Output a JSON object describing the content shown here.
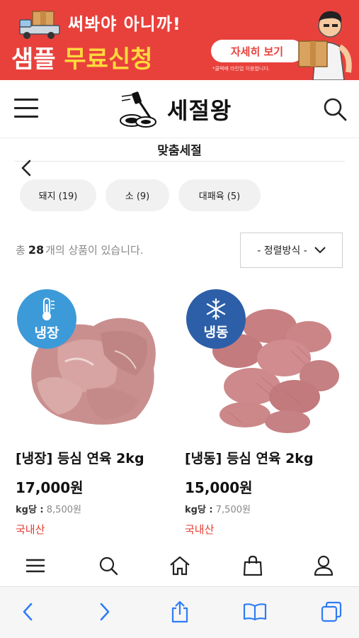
{
  "colors": {
    "banner_bg": "#e8413c",
    "banner_accent": "#ffd93d",
    "chilled_badge": "#3d9ad9",
    "frozen_badge": "#2d5fa8",
    "origin_text": "#e53b30",
    "browser_icon": "#2f7cf6"
  },
  "banner": {
    "tagline": "써봐야 아니까!",
    "headline_part1": "샘플 ",
    "headline_part2": "무료신청",
    "detail_button": "자세히 보기",
    "note": "*쿨택배 라인업 이용합니다."
  },
  "header": {
    "logo_text": "세절왕",
    "menu_icon": "hamburger-menu-icon",
    "search_icon": "search-icon"
  },
  "category": {
    "title": "맞춤세절",
    "chips": [
      {
        "label": "돼지 (19)"
      },
      {
        "label": "소 (9)"
      },
      {
        "label": "대패육 (5)"
      }
    ]
  },
  "listing": {
    "count_prefix": "총",
    "count_value": "28",
    "count_suffix": "개의 상품이 있습니다.",
    "sort_label": "- 정렬방식 -"
  },
  "products": [
    {
      "badge": "냉장",
      "badge_icon": "thermometer-icon",
      "name": "[냉장] 등심 연육 2kg",
      "price": "17,000원",
      "unit_label": "kg당 :",
      "unit_price": "8,500원",
      "origin": "국내산"
    },
    {
      "badge": "냉동",
      "badge_icon": "snowflake-icon",
      "name": "[냉동] 등심 연육 2kg",
      "price": "15,000원",
      "unit_label": "kg당 :",
      "unit_price": "7,500원",
      "origin": "국내산"
    }
  ],
  "bottom_nav": [
    "menu-icon",
    "search-icon",
    "home-icon",
    "shopping-bag-icon",
    "user-icon"
  ],
  "browser_toolbar": [
    "back-icon",
    "forward-icon",
    "share-icon",
    "bookmarks-icon",
    "tabs-icon"
  ]
}
